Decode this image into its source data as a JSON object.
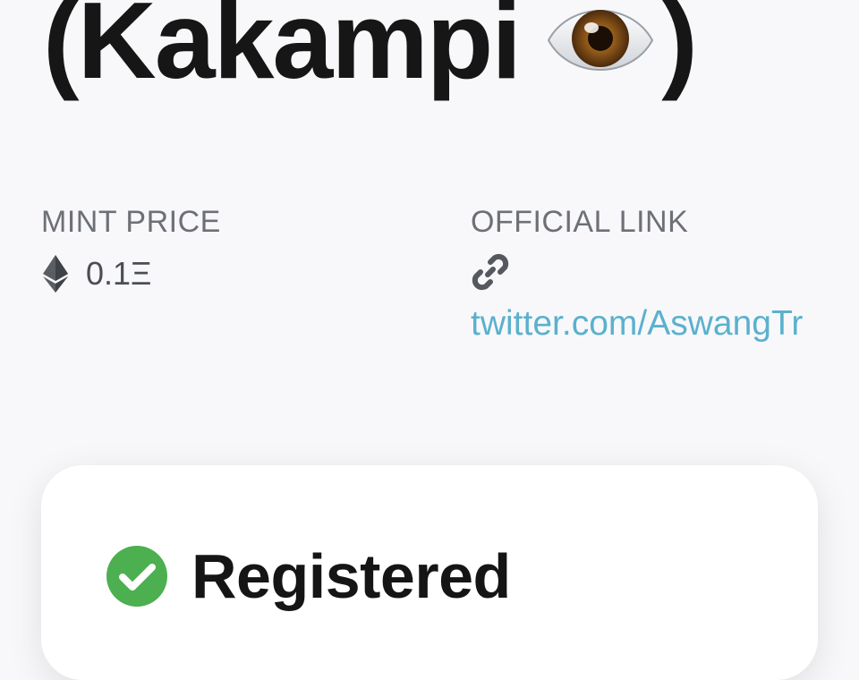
{
  "header": {
    "title_open": "(Kakampi",
    "title_emoji_icon": "eye-icon",
    "title_close": ")"
  },
  "mint_price": {
    "label": "MINT PRICE",
    "icon": "ethereum-icon",
    "value": "0.1Ξ"
  },
  "official_link": {
    "label": "OFFICIAL LINK",
    "icon": "link-icon",
    "url_text": "twitter.com/AswangTr"
  },
  "status": {
    "icon": "check-circle-icon",
    "label": "Registered",
    "icon_color": "#4caf50"
  },
  "colors": {
    "background": "#f8f8fa",
    "link": "#5ab1ce",
    "label_gray": "#6d7077",
    "card": "#ffffff"
  }
}
